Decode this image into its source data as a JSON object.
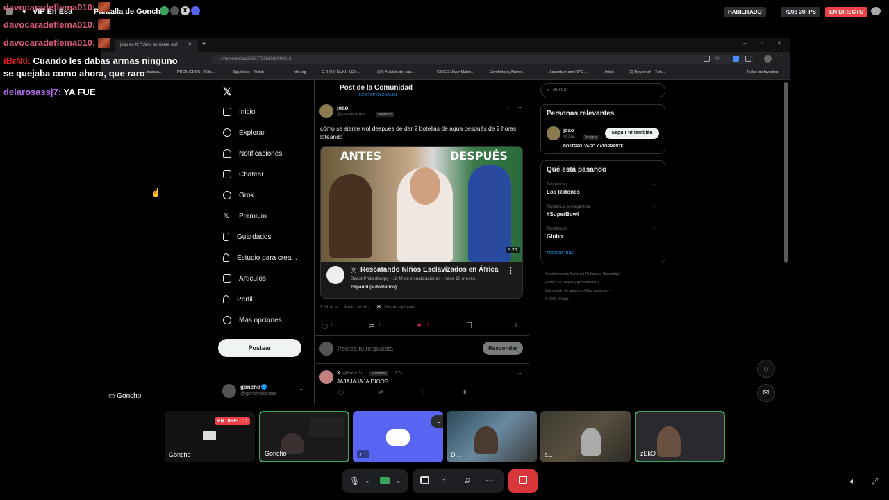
{
  "topbar": {
    "channel_label": "VIP En Esa",
    "share_label": "Pantalla de Goncho",
    "enabled_badge": "HABILITADO",
    "quality_badge": "720p 30FPS",
    "live_badge": "EN DIRECTO"
  },
  "chat": [
    {
      "user": "davocaradeflema010:",
      "text": "",
      "color": "#e05a7a",
      "emote": true
    },
    {
      "user": "davocaradeflema010:",
      "text": "",
      "color": "#e05a7a",
      "emote": true
    },
    {
      "user": "davocaradeflema010:",
      "text": "",
      "color": "#e05a7a",
      "emote": true
    },
    {
      "user": "iBrN0:",
      "text": "Cuando les dabas armas ninguno",
      "color": "#e02020",
      "emote": false
    },
    {
      "user": "",
      "text": "se quejaba como ahora, que raro",
      "color": "#e02020",
      "emote": false
    },
    {
      "user": "delarosassj7:",
      "text": "YA FUE",
      "color": "#b36cf0",
      "emote": false
    }
  ],
  "browser": {
    "tab_title": "joao en X: \"cómo se siente wol\"",
    "url": "...menté/status/2020772563602002019",
    "bookmarks": [
      "...maicas..",
      "PROMIEDOS - Fútb...",
      "Siguiendo - Twitch",
      "hltv.org",
      "C.R.O X DUKI - LEX...",
      "(57) Análisis del can...",
      "CS:GO Major Match...",
      "Comfortably Numb...",
      "Adventure and RPG...",
      "Inicio",
      "(3) Iforvichich - Twit...",
      "Todos los favoritos"
    ]
  },
  "x": {
    "nav": [
      "Inicio",
      "Explorar",
      "Notificaciones",
      "Chatear",
      "Grok",
      "Premium",
      "Guardados",
      "Estudio para crea...",
      "Artículos",
      "Perfil",
      "Más opciones"
    ],
    "post_button": "Postear",
    "account_name": "goncho",
    "account_handle": "@gonchobanzas",
    "header_title": "Post de la Comunidad",
    "header_sub": "LOS TOP GLOBALES",
    "post_user": "joao",
    "post_handle": "@joacorriente",
    "post_badge": "Miembro",
    "post_text": "cómo se siente wol después de dar 2 botellas de agua después de 2 horas loteando",
    "thumb_left": "ANTES",
    "thumb_right": "DESPUÉS",
    "thumb_duration": "5:26",
    "video_title": "Rescatando Niños Esclavizados en África",
    "video_meta": "Beast Philanthropy · 18 M de visualizaciones · hace 10 meses",
    "video_lang": "Español (automático)",
    "post_time": "5:11 a. m. · 9 feb. 2026 ·",
    "post_views": "29",
    "post_views_label": "Visualizaciones",
    "replies_count": "1",
    "reposts_count": "1",
    "likes_count": "2",
    "reply_placeholder": "Postea tu respuesta",
    "reply_button": "Responder",
    "reply_user": "X",
    "reply_handle": "@Fulbo3r",
    "reply_badge": "Miembro",
    "reply_time": "57s",
    "reply_text": "JAJAJAJAJA DIOOS.",
    "search_placeholder": "Buscar",
    "relevant_title": "Personas relevantes",
    "relevant_name": "joao",
    "relevant_handle": "@Joa...",
    "relevant_follow_badge": "Te sigue",
    "relevant_bio": "BOSTERO, VAGO Y ATORRANTE",
    "follow_button": "Seguir tú también",
    "trending_title": "Qué está pasando",
    "trends": [
      {
        "context": "Tendencias",
        "name": "Los Ratones"
      },
      {
        "context": "Tendencia en Argentina",
        "name": "#SuperBowl"
      },
      {
        "context": "Tendencias",
        "name": "Globo"
      }
    ],
    "show_more": "Mostrar más",
    "footer": [
      "Condiciones de Servicio",
      "Política de Privacidad",
      "Política de cookies",
      "Accesibilidad",
      "Información de anuncios",
      "Más opciones ···",
      "© 2026 X Corp."
    ]
  },
  "stream": {
    "screen_label": "Goncho",
    "tiles": [
      {
        "label": "Goncho",
        "live": "EN DIRECTO"
      },
      {
        "label": "Goncho"
      },
      {
        "label": "r..."
      },
      {
        "label": "D..."
      },
      {
        "label": "c..."
      },
      {
        "label": "zEkO"
      }
    ]
  },
  "colors": {
    "accent": "#1d9bf0",
    "live": "#ed4245",
    "discord": "#5865f2",
    "like": "#f91880"
  }
}
